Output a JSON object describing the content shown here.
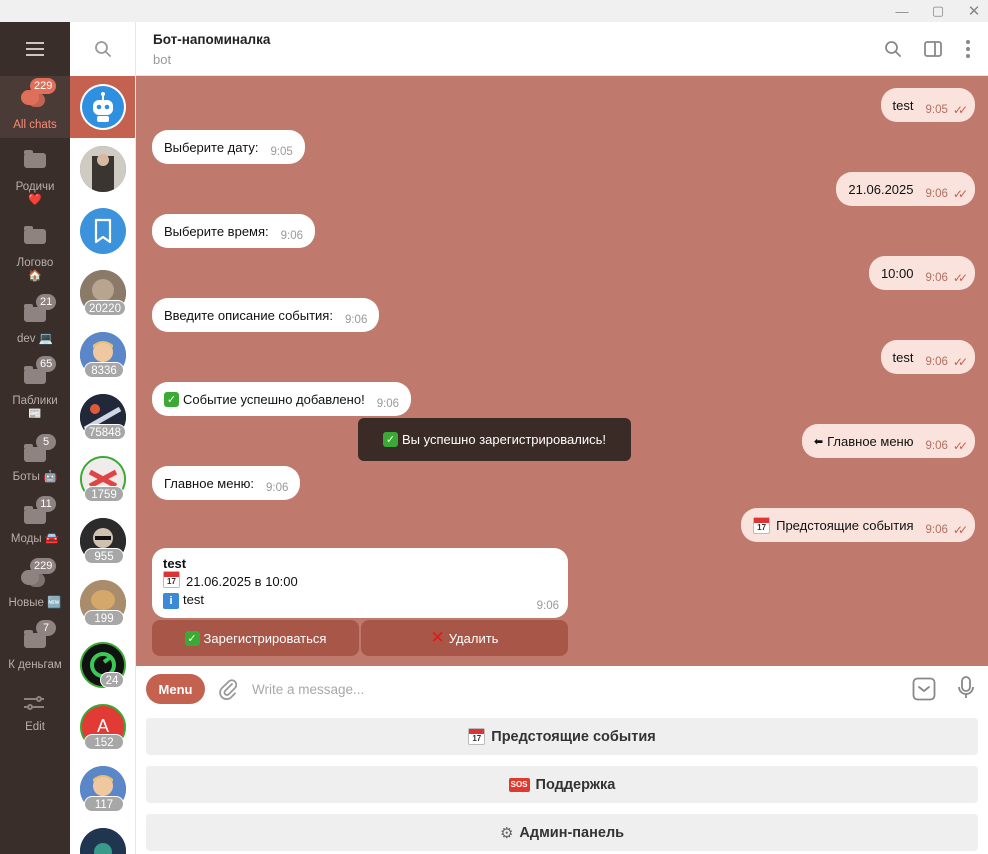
{
  "window": {
    "minimize": "—",
    "maximize": "▢",
    "close": "✕"
  },
  "rail": {
    "folders": [
      {
        "label": "All chats",
        "emoji": "",
        "badge": "229"
      },
      {
        "label": "Родичи",
        "emoji": "❤️",
        "badge": ""
      },
      {
        "label": "Логово",
        "emoji": "🏠",
        "badge": ""
      },
      {
        "label": "dev",
        "emoji": "💻",
        "badge": "21"
      },
      {
        "label": "Паблики",
        "emoji": "📰",
        "badge": "65"
      },
      {
        "label": "Боты",
        "emoji": "🤖",
        "badge": "5"
      },
      {
        "label": "Моды",
        "emoji": "🚘",
        "badge": "11"
      },
      {
        "label": "Новые",
        "emoji": "🆕",
        "badge": "229"
      },
      {
        "label": "К деньгам",
        "emoji": "",
        "badge": "7"
      },
      {
        "label": "Edit",
        "emoji": "",
        "badge": ""
      }
    ]
  },
  "chats": [
    {
      "unread": "",
      "color": "#2f8fe0"
    },
    {
      "unread": "",
      "color": "#5a5550"
    },
    {
      "unread": "",
      "color": "#3d92dc"
    },
    {
      "unread": "20220",
      "color": "#7a6a5a"
    },
    {
      "unread": "8336",
      "color": "#4d77b8"
    },
    {
      "unread": "75848",
      "color": "#2b2a3a"
    },
    {
      "unread": "1759",
      "color": "#e9e3e3"
    },
    {
      "unread": "955",
      "color": "#2a2a2a"
    },
    {
      "unread": "199",
      "color": "#b08858"
    },
    {
      "unread": "24",
      "color": "#111111"
    },
    {
      "unread": "152",
      "color": "#e23b36"
    },
    {
      "unread": "117",
      "color": "#4d77b8"
    },
    {
      "unread": "",
      "color": "#2f4d6e"
    }
  ],
  "header": {
    "title": "Бот-напоминалка",
    "subtitle": "bot"
  },
  "messages": [
    {
      "dir": "out",
      "text": "test",
      "time": "9:05"
    },
    {
      "dir": "in",
      "text": "Выберите дату:",
      "time": "9:05"
    },
    {
      "dir": "out",
      "text": "21.06.2025",
      "time": "9:06"
    },
    {
      "dir": "in",
      "text": "Выберите время:",
      "time": "9:06"
    },
    {
      "dir": "out",
      "text": "10:00",
      "time": "9:06"
    },
    {
      "dir": "in",
      "text": "Введите описание события:",
      "time": "9:06"
    },
    {
      "dir": "out",
      "text": "test",
      "time": "9:06"
    },
    {
      "dir": "in",
      "text": "Событие успешно добавлено!",
      "time": "9:06"
    },
    {
      "dir": "out",
      "text": "Главное меню",
      "time": "9:06"
    },
    {
      "dir": "in",
      "text": "Главное меню:",
      "time": "9:06"
    },
    {
      "dir": "out",
      "text": "Предстоящие события",
      "time": "9:06"
    }
  ],
  "toast": "Вы успешно зарегистрировались!",
  "card": {
    "title": "test",
    "date_line": "21.06.2025 в 10:00",
    "info_line": "test",
    "time": "9:06",
    "register_label": "Зарегистрироваться",
    "delete_label": "Удалить"
  },
  "compose": {
    "menu_label": "Menu",
    "placeholder": "Write a message..."
  },
  "reply_keyboard": {
    "events_label": "Предстоящие события",
    "support_label": "Поддержка",
    "admin_label": "Админ-панель"
  },
  "colors": {
    "accent": "#c4614f",
    "chat_bg": "#c07a6d",
    "rail_bg": "#3a2e2b",
    "out_bubble": "#f9e3dc"
  }
}
